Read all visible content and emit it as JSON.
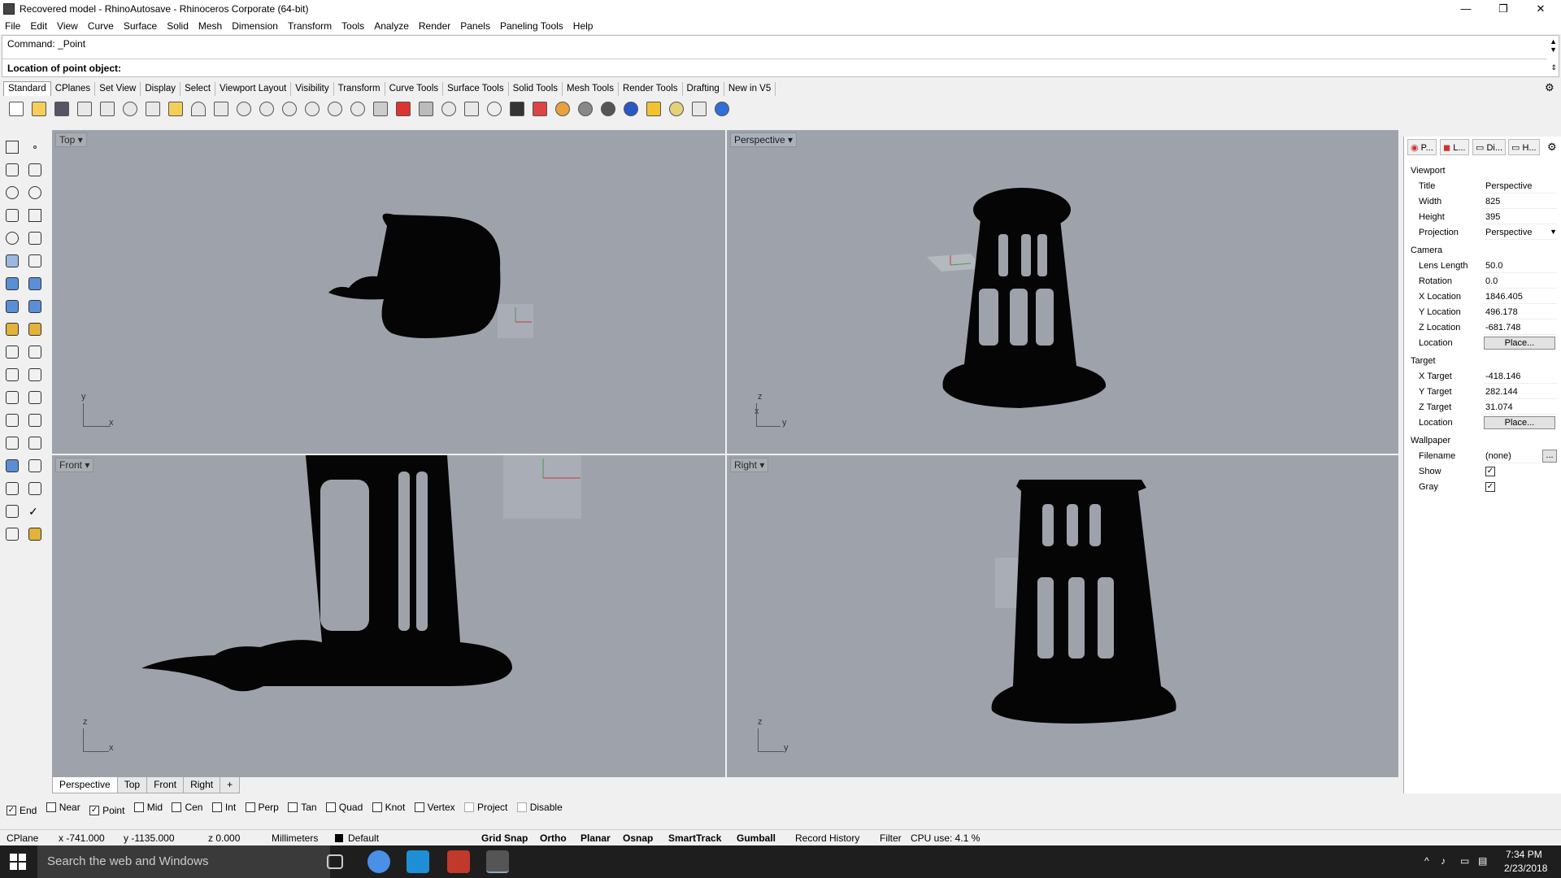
{
  "window": {
    "title": "Recovered model - RhinoAutosave - Rhinoceros Corporate (64-bit)",
    "minimize": "—",
    "maximize": "❐",
    "close": "✕"
  },
  "menu": [
    "File",
    "Edit",
    "View",
    "Curve",
    "Surface",
    "Solid",
    "Mesh",
    "Dimension",
    "Transform",
    "Tools",
    "Analyze",
    "Render",
    "Panels",
    "Paneling Tools",
    "Help"
  ],
  "command": {
    "history": "Command: _Point",
    "prompt": "Location of point object:"
  },
  "toolbar_tabs": [
    "Standard",
    "CPlanes",
    "Set View",
    "Display",
    "Select",
    "Viewport Layout",
    "Visibility",
    "Transform",
    "Curve Tools",
    "Surface Tools",
    "Solid Tools",
    "Mesh Tools",
    "Render Tools",
    "Drafting",
    "New in V5"
  ],
  "viewports": {
    "top": {
      "label": "Top",
      "axis_v": "y",
      "axis_h": "x"
    },
    "perspective": {
      "label": "Perspective",
      "axis_v": "z",
      "axis_h": "y",
      "axis_d": "x"
    },
    "front": {
      "label": "Front",
      "axis_v": "z",
      "axis_h": "x"
    },
    "right": {
      "label": "Right",
      "axis_v": "z",
      "axis_h": "y"
    }
  },
  "viewport_tabs": [
    "Perspective",
    "Top",
    "Front",
    "Right",
    "+"
  ],
  "osnaps": [
    {
      "label": "End",
      "checked": true
    },
    {
      "label": "Near",
      "checked": false
    },
    {
      "label": "Point",
      "checked": true
    },
    {
      "label": "Mid",
      "checked": false
    },
    {
      "label": "Cen",
      "checked": false
    },
    {
      "label": "Int",
      "checked": false
    },
    {
      "label": "Perp",
      "checked": false
    },
    {
      "label": "Tan",
      "checked": false
    },
    {
      "label": "Quad",
      "checked": false
    },
    {
      "label": "Knot",
      "checked": false
    },
    {
      "label": "Vertex",
      "checked": false
    },
    {
      "label": "Project",
      "checked": false
    },
    {
      "label": "Disable",
      "checked": false
    }
  ],
  "status": {
    "cplane": "CPlane",
    "x": "x -741.000",
    "y": "y -1135.000",
    "z": "z 0.000",
    "units": "Millimeters",
    "layer": "Default",
    "grid_snap": "Grid Snap",
    "ortho": "Ortho",
    "planar": "Planar",
    "osnap": "Osnap",
    "smarttrack": "SmartTrack",
    "gumball": "Gumball",
    "record_history": "Record History",
    "filter": "Filter",
    "cpu": "CPU use: 4.1 %"
  },
  "panel": {
    "tabs": [
      "P...",
      "L...",
      "Di...",
      "H..."
    ],
    "sections": {
      "viewport": "Viewport",
      "camera": "Camera",
      "target": "Target",
      "wallpaper": "Wallpaper"
    },
    "labels": {
      "title": "Title",
      "width": "Width",
      "height": "Height",
      "projection": "Projection",
      "lens": "Lens Length",
      "rotation": "Rotation",
      "xloc": "X Location",
      "yloc": "Y Location",
      "zloc": "Z Location",
      "location": "Location",
      "xt": "X Target",
      "yt": "Y Target",
      "zt": "Z Target",
      "location2": "Location",
      "filename": "Filename",
      "show": "Show",
      "gray": "Gray"
    },
    "values": {
      "title": "Perspective",
      "width": "825",
      "height": "395",
      "projection": "Perspective",
      "lens": "50.0",
      "rotation": "0.0",
      "xloc": "1846.405",
      "yloc": "496.178",
      "zloc": "-681.748",
      "place": "Place...",
      "xt": "-418.146",
      "yt": "282.144",
      "zt": "31.074",
      "place2": "Place...",
      "filename": "(none)",
      "dots": "..."
    }
  },
  "taskbar": {
    "search": "Search the web and Windows",
    "time": "7:34 PM",
    "date": "2/23/2018"
  }
}
